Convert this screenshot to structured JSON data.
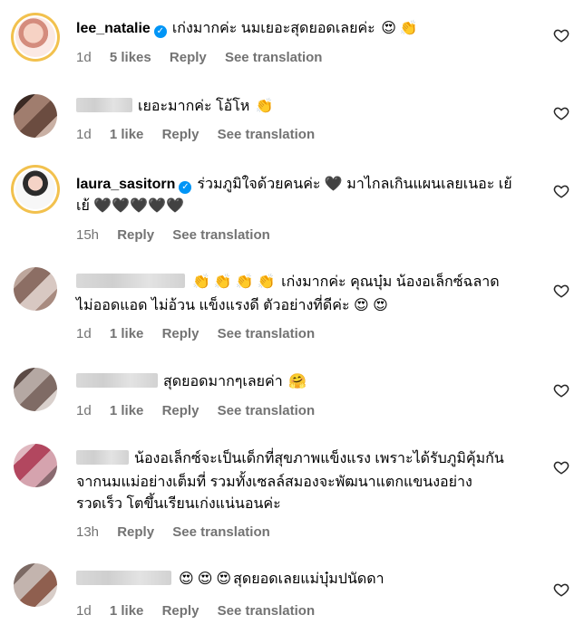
{
  "comments": [
    {
      "username": "lee_natalie",
      "verified": true,
      "text": "เก่งมากค่ะ นมเยอะสุดยอดเลยค่ะ",
      "emojis": [
        "😍",
        "👏"
      ],
      "time": "1d",
      "likes": "5 likes",
      "reply": "Reply",
      "translate": "See translation"
    },
    {
      "username": "",
      "text": "เยอะมากค่ะ โอ้โห",
      "emojis": [
        "👏"
      ],
      "time": "1d",
      "likes": "1 like",
      "reply": "Reply",
      "translate": "See translation"
    },
    {
      "username": "laura_sasitorn",
      "verified": true,
      "text_line1": "ร่วมภูมิใจด้วยคนค่ะ 🖤 มาไกลเกินแผนเลยเนอะ เย้",
      "text_line2": "เย้ 🖤🖤🖤🖤🖤",
      "time": "15h",
      "reply": "Reply",
      "translate": "See translation"
    },
    {
      "username": "",
      "emojis_lead": [
        "👏",
        "👏",
        "👏",
        "👏"
      ],
      "text_line1": "เก่งมากค่ะ คุณบุ๋ม น้องอเล็กซ์ฉลาด",
      "text_line2": "ไม่ออดแอด ไม่อ้วน แข็งแรงดี ตัวอย่างที่ดีค่ะ 😍 😍",
      "time": "1d",
      "likes": "1 like",
      "reply": "Reply",
      "translate": "See translation"
    },
    {
      "username": "",
      "text": "สุดยอดมากๆเลยค่า",
      "emojis": [
        "🤗"
      ],
      "time": "1d",
      "likes": "1 like",
      "reply": "Reply",
      "translate": "See translation"
    },
    {
      "username": "",
      "text_line1": "น้องอเล็กซ์จะเป็นเด็กที่สุขภาพแข็งแรง เพราะได้รับภูมิคุ้มกัน",
      "text_line2": "จากนมแม่อย่างเต็มที่ รวมทั้งเซลล์สมองจะพัฒนาแตกแขนงอย่าง",
      "text_line3": "รวดเร็ว โตขึ้นเรียนเก่งแน่นอนค่ะ",
      "time": "13h",
      "reply": "Reply",
      "translate": "See translation"
    },
    {
      "username": "",
      "emojis_lead": [
        "😍",
        "😍",
        "😍"
      ],
      "text": "สุดยอดเลยแม่บุ๋มปนัดดา",
      "time": "1d",
      "likes": "1 like",
      "reply": "Reply",
      "translate": "See translation"
    }
  ],
  "icons": {
    "like": "heart-outline-icon",
    "verified": "verified-badge-icon"
  },
  "colors": {
    "meta": "#737373",
    "verified": "#0095f6",
    "story_ring": "#f2c14e"
  }
}
